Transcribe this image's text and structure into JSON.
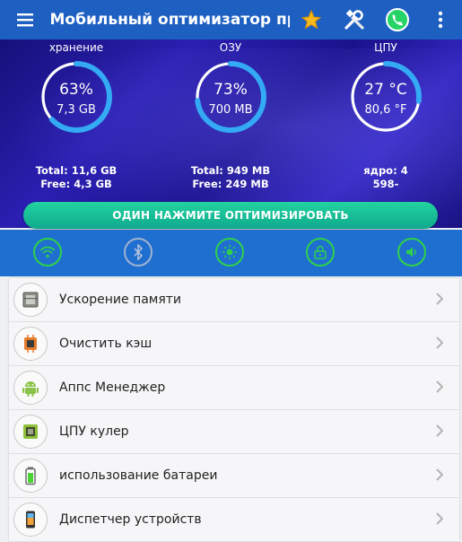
{
  "app": {
    "title": "Мобильный оптимизатор пр…"
  },
  "stats": {
    "storage": {
      "label": "хранение",
      "percent_text": "63%",
      "size_text": "7,3 GB",
      "fraction": 0.63,
      "total": "Total: 11,6 GB",
      "free": "Free: 4,3 GB"
    },
    "ram": {
      "label": "ОЗУ",
      "percent_text": "73%",
      "size_text": "700 MB",
      "fraction": 0.73,
      "total": "Total: 949 MB",
      "free": "Free: 249 MB"
    },
    "cpu": {
      "label": "ЦПУ",
      "temp_c": "27 °C",
      "temp_f": "80,6 °F",
      "fraction": 0.27,
      "cores": "ядро: 4",
      "freq": "598-"
    }
  },
  "optimize_button": "ОДИН НАЖМИТЕ ОПТИМИЗИРОВАТЬ",
  "toggles": [
    {
      "name": "wifi",
      "active": true
    },
    {
      "name": "bluetooth",
      "active": false
    },
    {
      "name": "brightness",
      "active": true
    },
    {
      "name": "rotation-lock",
      "active": true
    },
    {
      "name": "sound",
      "active": true
    }
  ],
  "menu": [
    {
      "label": "Ускорение памяти",
      "icon": "memory-chip-icon"
    },
    {
      "label": "Очистить кэш",
      "icon": "cache-chip-icon"
    },
    {
      "label": "Аппс Менеджер",
      "icon": "android-icon"
    },
    {
      "label": "ЦПУ кулер",
      "icon": "cpu-icon"
    },
    {
      "label": "использование батареи",
      "icon": "battery-icon"
    },
    {
      "label": "Диспетчер устройств",
      "icon": "phone-icon"
    }
  ],
  "colors": {
    "appbar": "#1e5fc2",
    "ring": "#34a9f4",
    "toggle_active": "#2fd24a",
    "button": "#17c19a"
  }
}
